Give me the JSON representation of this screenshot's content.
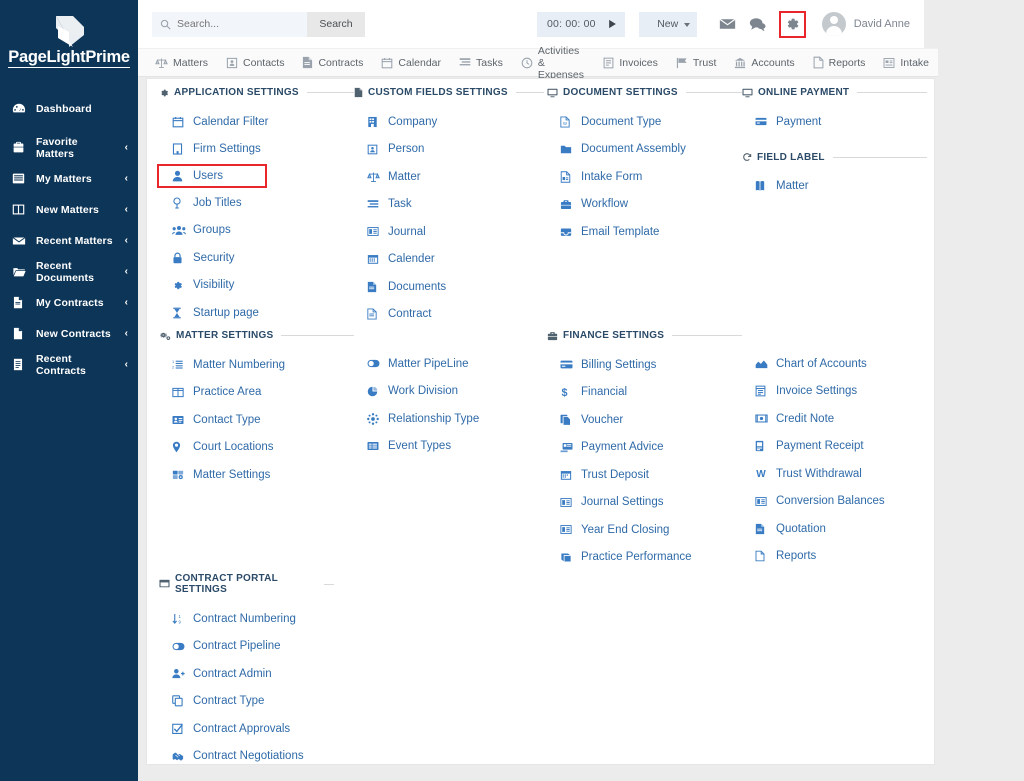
{
  "brand": {
    "name": "PageLightPrime",
    "logo_icon": "chevron-logo-icon"
  },
  "colors": {
    "sidebar_bg": "#0d3557",
    "link_blue": "#2f6aa8",
    "icon_blue": "#3a7cc3",
    "highlight_red": "#e8262b",
    "section_heading": "#2a4a68"
  },
  "sidebar": {
    "items": [
      {
        "label": "Dashboard",
        "icon": "dashboard-icon",
        "chevron": ""
      },
      {
        "label": "Favorite Matters",
        "icon": "briefcase-icon",
        "chevron": "‹"
      },
      {
        "label": "My Matters",
        "icon": "list-icon",
        "chevron": "‹"
      },
      {
        "label": "New Matters",
        "icon": "columns-icon",
        "chevron": "‹"
      },
      {
        "label": "Recent Matters",
        "icon": "envelope-icon",
        "chevron": "‹"
      },
      {
        "label": "Recent Documents",
        "icon": "folder-open-icon",
        "chevron": "‹"
      },
      {
        "label": "My Contracts",
        "icon": "file-icon",
        "chevron": "‹"
      },
      {
        "label": "New Contracts",
        "icon": "file-blank-icon",
        "chevron": "‹"
      },
      {
        "label": "Recent Contracts",
        "icon": "file-lines-icon",
        "chevron": "‹"
      }
    ]
  },
  "topbar": {
    "search": {
      "placeholder": "Search...",
      "value": "",
      "icon": "search-icon"
    },
    "search_button": "Search",
    "timer": {
      "value": "00: 00: 00",
      "play_icon": "play-icon"
    },
    "new_button": {
      "label": "New",
      "caret_icon": "chevron-down-icon"
    },
    "icons": [
      {
        "name": "envelope-icon"
      },
      {
        "name": "chat-icon"
      },
      {
        "name": "gear-icon"
      }
    ],
    "user": {
      "name": "David Anne",
      "avatar_icon": "avatar-icon"
    }
  },
  "tabs": [
    {
      "label": "Matters",
      "icon": "scales-icon"
    },
    {
      "label": "Contacts",
      "icon": "contact-card-icon"
    },
    {
      "label": "Contracts",
      "icon": "document-icon"
    },
    {
      "label": "Calendar",
      "icon": "calendar-icon"
    },
    {
      "label": "Tasks",
      "icon": "tasks-icon"
    },
    {
      "label": "Activities & Expenses",
      "icon": "clock-icon"
    },
    {
      "label": "Invoices",
      "icon": "invoice-icon"
    },
    {
      "label": "Trust",
      "icon": "flag-icon"
    },
    {
      "label": "Accounts",
      "icon": "bank-icon"
    },
    {
      "label": "Reports",
      "icon": "report-icon"
    },
    {
      "label": "Intake",
      "icon": "intake-icon"
    }
  ],
  "sections": {
    "application_settings": {
      "title": "Application Settings",
      "icon": "gear-icon",
      "items": [
        {
          "label": "Calendar Filter",
          "icon": "calendar-icon",
          "highlighted": false
        },
        {
          "label": "Firm Settings",
          "icon": "building-icon",
          "highlighted": false
        },
        {
          "label": "Users",
          "icon": "user-icon",
          "highlighted": true
        },
        {
          "label": "Job Titles",
          "icon": "badge-icon",
          "highlighted": false
        },
        {
          "label": "Groups",
          "icon": "users-group-icon",
          "highlighted": false
        },
        {
          "label": "Security",
          "icon": "lock-icon",
          "highlighted": false
        },
        {
          "label": "Visibility",
          "icon": "gear-icon",
          "highlighted": false
        },
        {
          "label": "Startup page",
          "icon": "hourglass-icon",
          "highlighted": false
        }
      ]
    },
    "custom_fields_settings": {
      "title": "Custom Fields Settings",
      "icon": "document-icon",
      "items": [
        {
          "label": "Company",
          "icon": "building-icon"
        },
        {
          "label": "Person",
          "icon": "contact-card-icon"
        },
        {
          "label": "Matter",
          "icon": "scales-icon"
        },
        {
          "label": "Task",
          "icon": "tasks-icon"
        },
        {
          "label": "Journal",
          "icon": "journal-icon"
        },
        {
          "label": "Calender",
          "icon": "calendar-icon"
        },
        {
          "label": "Documents",
          "icon": "document-icon"
        },
        {
          "label": "Contract",
          "icon": "contract-icon"
        }
      ]
    },
    "document_settings": {
      "title": "Document Settings",
      "icon": "monitor-icon",
      "items": [
        {
          "label": "Document Type",
          "icon": "doc-word-icon"
        },
        {
          "label": "Document Assembly",
          "icon": "folder-icon"
        },
        {
          "label": "Intake Form",
          "icon": "form-icon"
        },
        {
          "label": "Workflow",
          "icon": "briefcase-icon"
        },
        {
          "label": "Email Template",
          "icon": "inbox-icon"
        }
      ]
    },
    "online_payment": {
      "title": "Online Payment",
      "icon": "monitor-icon",
      "items": [
        {
          "label": "Payment",
          "icon": "credit-card-icon"
        }
      ]
    },
    "field_label": {
      "title": "Field Label",
      "icon": "refresh-icon",
      "items": [
        {
          "label": "Matter",
          "icon": "book-icon"
        }
      ]
    },
    "matter_settings": {
      "title": "Matter Settings",
      "icon": "cogs-icon",
      "items_col1": [
        {
          "label": "Matter Numbering",
          "icon": "ordered-list-icon"
        },
        {
          "label": "Practice Area",
          "icon": "columns-icon"
        },
        {
          "label": "Contact Type",
          "icon": "id-card-icon"
        },
        {
          "label": "Court Locations",
          "icon": "map-pin-icon"
        },
        {
          "label": "Matter Settings",
          "icon": "settings-group-icon"
        }
      ],
      "items_col2": [
        {
          "label": "Matter PipeLine",
          "icon": "toggle-icon"
        },
        {
          "label": "Work Division",
          "icon": "pie-chart-icon"
        },
        {
          "label": "Relationship Type",
          "icon": "network-icon"
        },
        {
          "label": "Event Types",
          "icon": "list-alt-icon"
        }
      ]
    },
    "finance_settings": {
      "title": "Finance Settings",
      "icon": "briefcase-icon",
      "items_col1": [
        {
          "label": "Billing Settings",
          "icon": "card-icon"
        },
        {
          "label": "Financial",
          "icon": "dollar-icon"
        },
        {
          "label": "Voucher",
          "icon": "copy-icon"
        },
        {
          "label": "Payment Advice",
          "icon": "payment-advice-icon"
        },
        {
          "label": "Trust Deposit",
          "icon": "calendar-icon"
        },
        {
          "label": "Journal Settings",
          "icon": "journal-icon"
        },
        {
          "label": "Year End Closing",
          "icon": "journal-icon"
        },
        {
          "label": "Practice Performance",
          "icon": "book-open-icon"
        }
      ],
      "items_col2": [
        {
          "label": "Chart of Accounts",
          "icon": "chart-area-icon"
        },
        {
          "label": "Invoice Settings",
          "icon": "invoice-icon"
        },
        {
          "label": "Credit Note",
          "icon": "credit-note-icon"
        },
        {
          "label": "Payment Receipt",
          "icon": "receipt-icon"
        },
        {
          "label": "Trust Withdrawal",
          "icon": "w-icon"
        },
        {
          "label": "Conversion Balances",
          "icon": "journal-icon"
        },
        {
          "label": "Quotation",
          "icon": "document-icon"
        },
        {
          "label": "Reports",
          "icon": "report-icon"
        }
      ]
    },
    "contract_portal_settings": {
      "title": "Contract Portal Settings",
      "icon": "window-icon",
      "items": [
        {
          "label": "Contract Numbering",
          "icon": "sort-numeric-icon"
        },
        {
          "label": "Contract Pipeline",
          "icon": "toggle-icon"
        },
        {
          "label": "Contract Admin",
          "icon": "user-plus-icon"
        },
        {
          "label": "Contract Type",
          "icon": "clone-icon"
        },
        {
          "label": "Contract Approvals",
          "icon": "check-square-icon"
        },
        {
          "label": "Contract Negotiations",
          "icon": "handshake-icon"
        }
      ]
    }
  }
}
